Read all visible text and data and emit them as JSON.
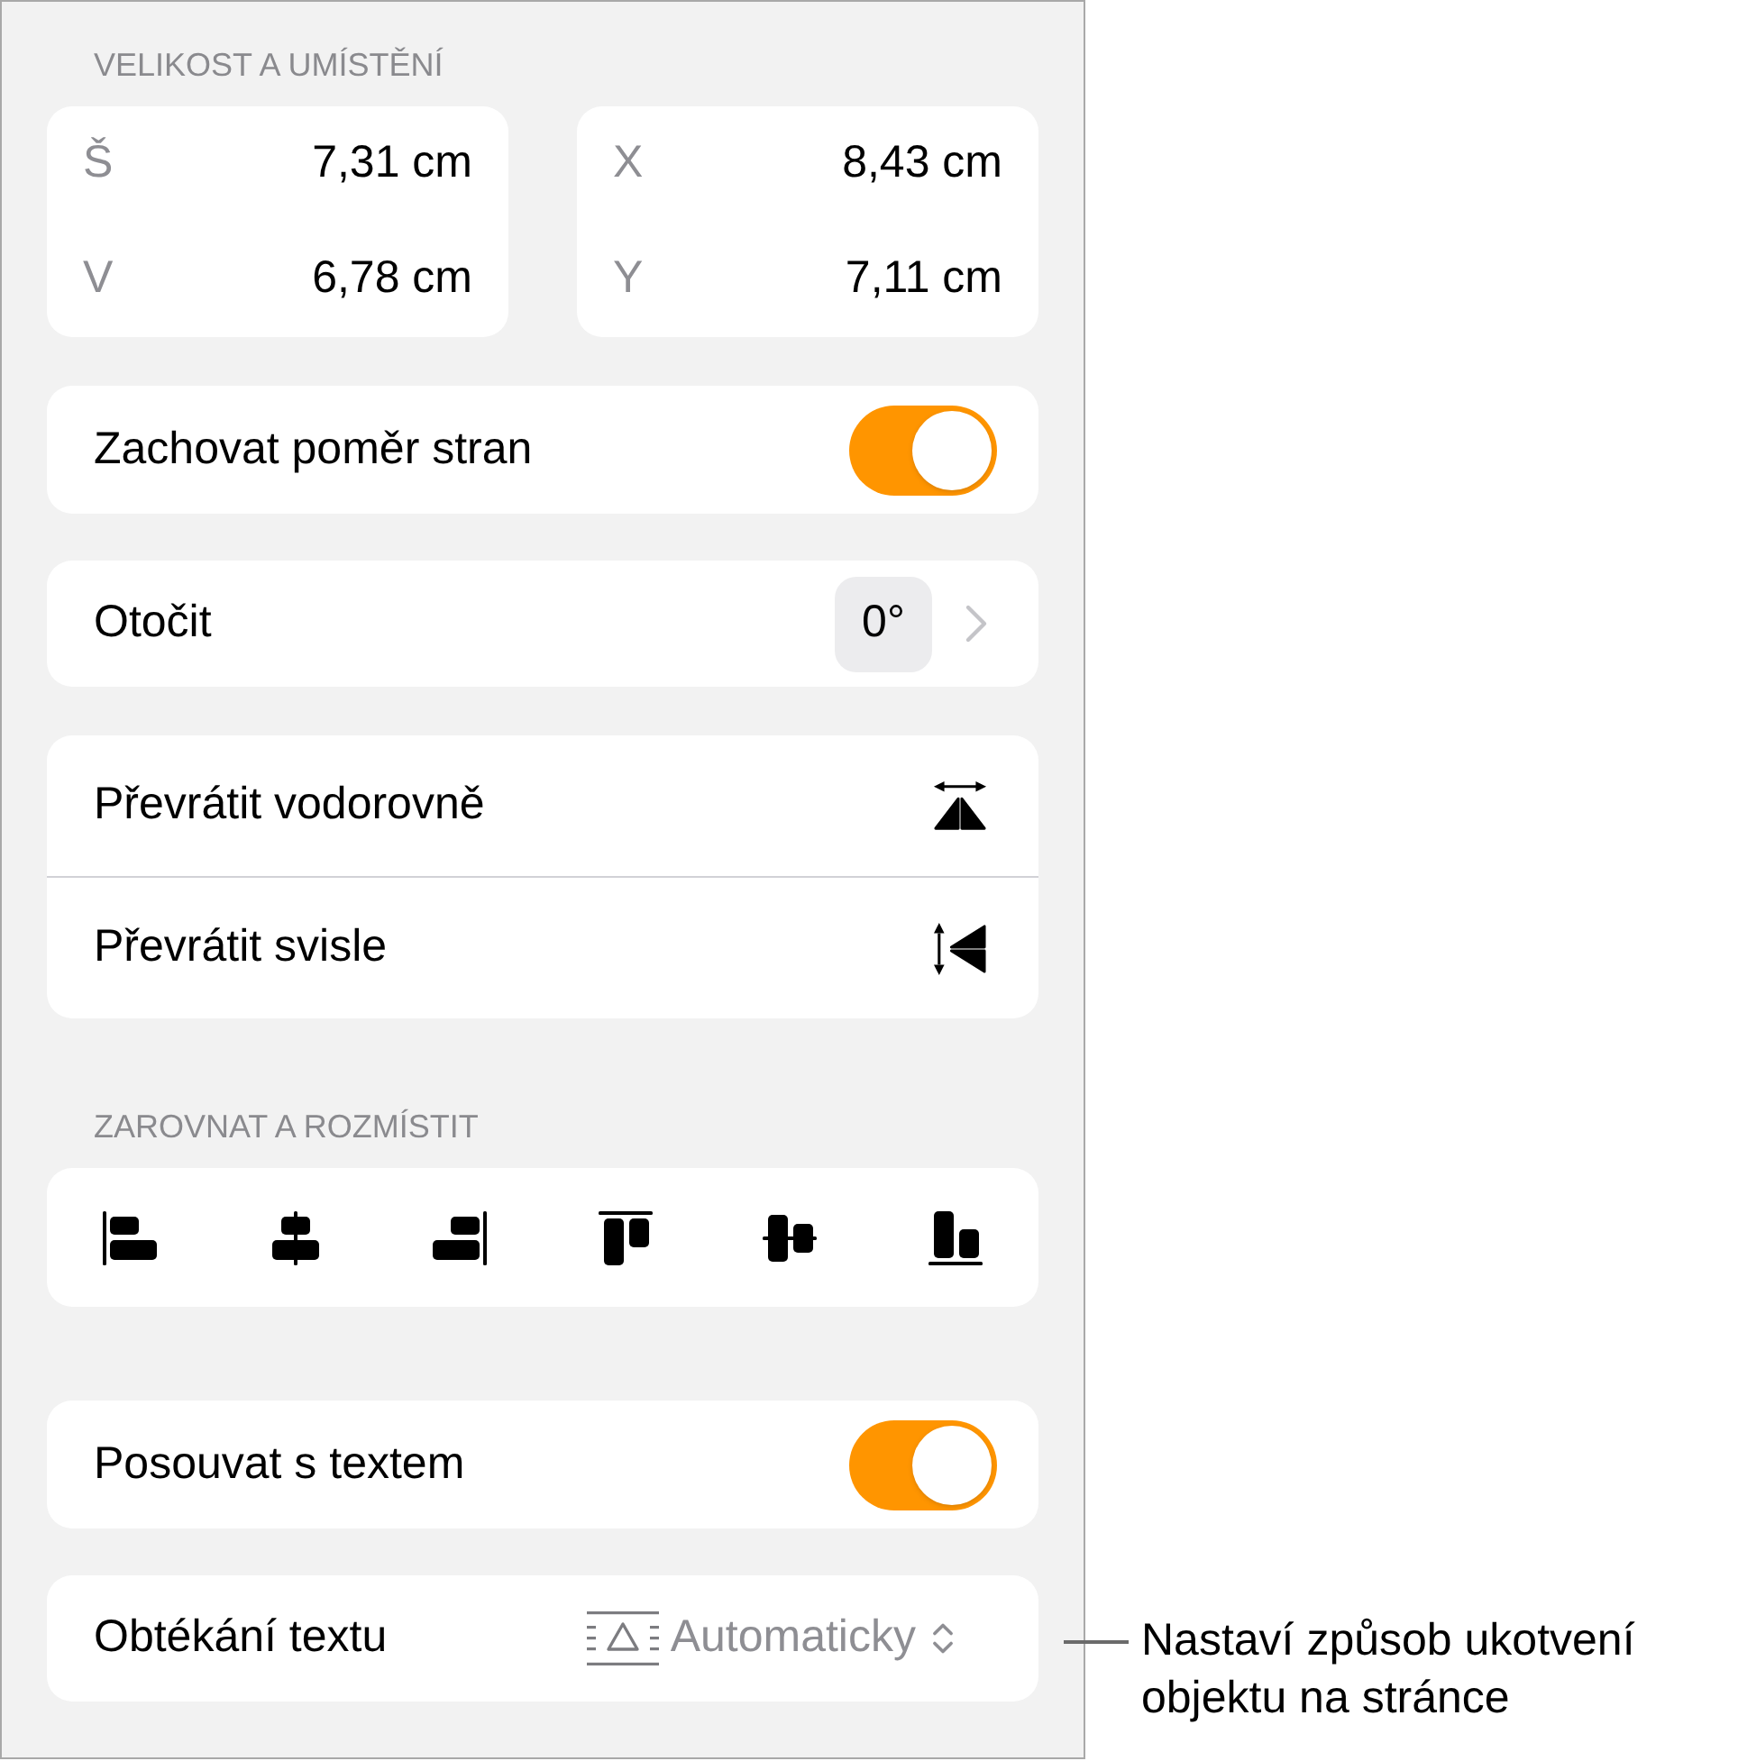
{
  "size_and_position": {
    "header": "VELIKOST A UMÍSTĚNÍ",
    "size": [
      {
        "label": "Š",
        "value": "7,31 cm"
      },
      {
        "label": "V",
        "value": "6,78 cm"
      }
    ],
    "position": [
      {
        "label": "X",
        "value": "8,43 cm"
      },
      {
        "label": "Y",
        "value": "7,11 cm"
      }
    ]
  },
  "constrain_proportions": {
    "label": "Zachovat poměr stran",
    "on": true
  },
  "rotate": {
    "label": "Otočit",
    "value": "0°"
  },
  "flip": [
    {
      "label": "Převrátit vodorovně"
    },
    {
      "label": "Převrátit svisle"
    }
  ],
  "align_and_distribute": {
    "header": "ZAROVNAT A ROZMÍSTIT"
  },
  "move_with_text": {
    "label": "Posouvat s textem",
    "on": true
  },
  "text_wrap": {
    "label": "Obtékání textu",
    "value": "Automaticky"
  },
  "callout": {
    "text": "Nastaví způsob ukotvení objektu na stránce"
  }
}
